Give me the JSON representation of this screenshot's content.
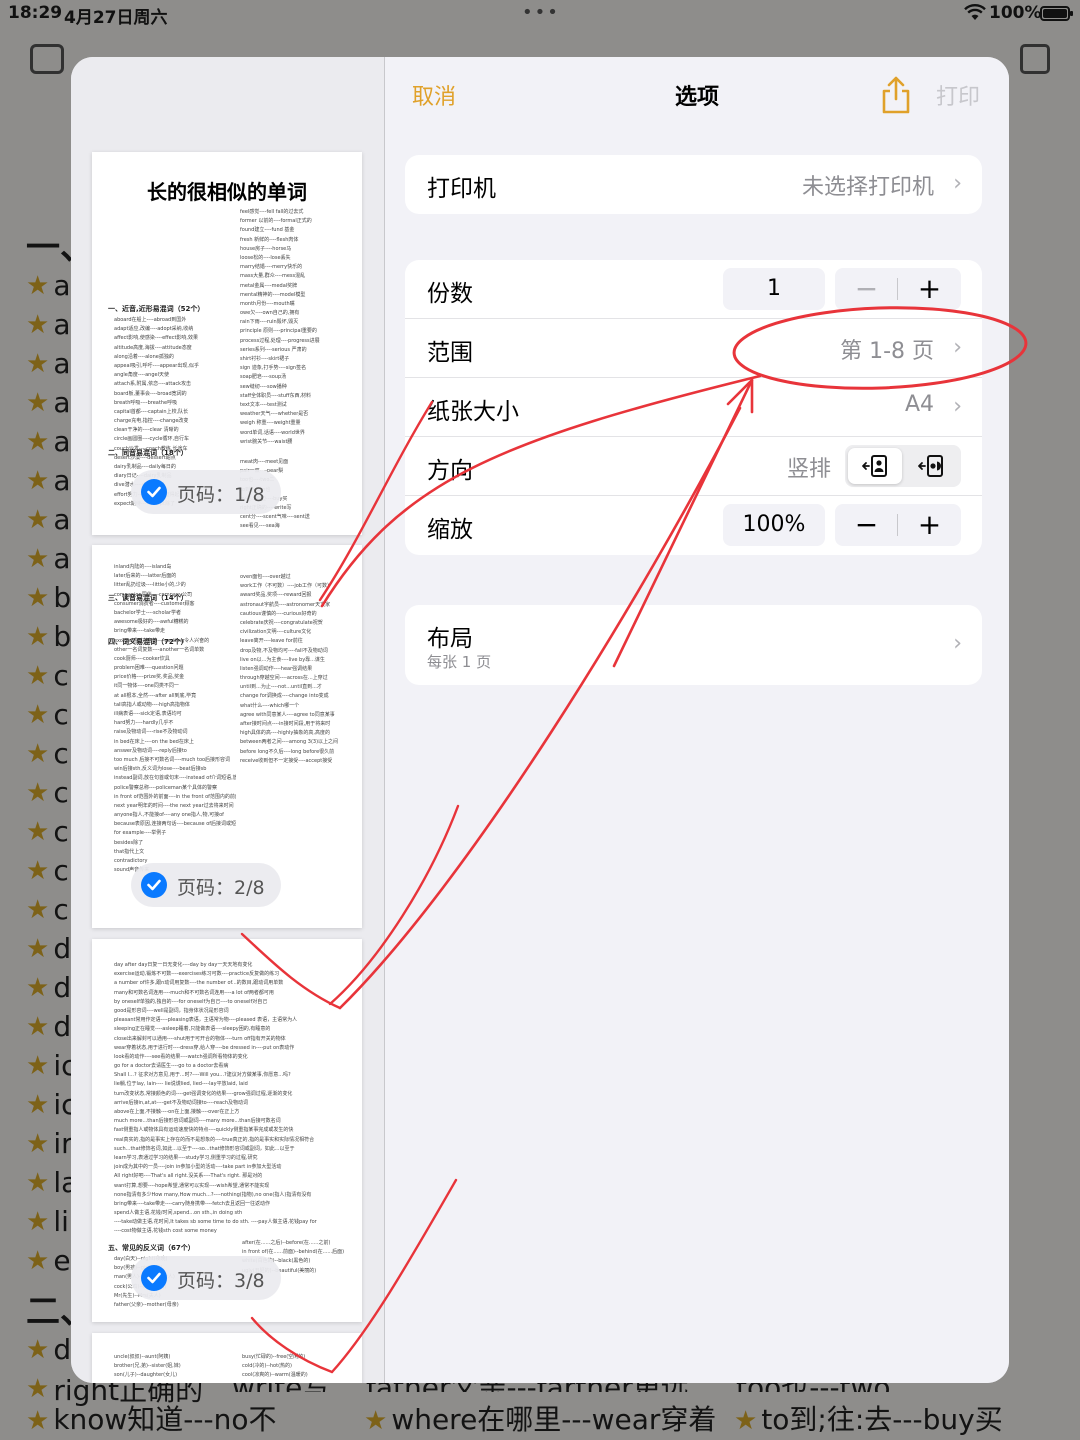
{
  "status_bar": {
    "time": "18:29",
    "date": "4月27日周六",
    "battery": "100%"
  },
  "background": {
    "left_heading_1": "一、",
    "left_heading_2": "二、",
    "left_rows": [
      "a",
      "a",
      "a",
      "a",
      "a",
      "a",
      "a",
      "a",
      "b",
      "b",
      "c",
      "c",
      "c",
      "c",
      "c",
      "c",
      "c",
      "d",
      "d",
      "d",
      "ic",
      "ic",
      "ir",
      "la",
      "li",
      "e"
    ],
    "left_rows_2": [
      "d",
      "right正确的"
    ],
    "bottom_row": [
      "know知道---no不",
      "where在哪里---wear穿着",
      "to到;往:去---buy买"
    ],
    "bottom_partial": [
      "write写",
      "father父亲---farther更远",
      "too也---two二"
    ]
  },
  "print_options": {
    "cancel": "取消",
    "title": "选项",
    "print": "打印",
    "printer": {
      "label": "打印机",
      "value": "未选择打印机"
    },
    "copies": {
      "label": "份数",
      "value": "1",
      "minus": "−",
      "plus": "+"
    },
    "range": {
      "label": "范围",
      "value": "第 1-8 页"
    },
    "paper_size": {
      "label": "纸张大小",
      "value": "A4"
    },
    "orientation": {
      "label": "方向",
      "value": "竖排"
    },
    "scale": {
      "label": "缩放",
      "value": "100%",
      "minus": "−",
      "plus": "+"
    },
    "layout": {
      "label": "布局",
      "sublabel": "每张 1 页"
    }
  },
  "preview": {
    "badges": [
      "页码：1/8",
      "页码：2/8",
      "页码：3/8"
    ],
    "page1": {
      "title": "长的很相似的单词",
      "heading_1": "一、近音,近形易混词（52个）",
      "heading_2": "二、同音易混词（18个）",
      "col_right": [
        "feel感觉----fell fall的过去式",
        "former 以前的----formal正式的",
        "found建立----fund 基金",
        "fresh 新鲜的----flesh肉体",
        "house房子----horse马",
        "loose松的----lose丢失",
        "marry结婚----merry快乐的",
        "mass大量,群众----mess混乱",
        "metal金属----medal奖牌",
        "mental精神的----model模型",
        "month月份----mouth嘴",
        "owe欠----own自己的,拥有",
        "rain下雨----ruin毁坏,毁灭",
        "principle 原则----principal重要的",
        "process过程,处理----progress进展",
        "series系列----serious 严肃的",
        "shirt衬衫----skirt裙子",
        "sign 迹象,打手势----sign签名",
        "soap肥皂----soup汤",
        "sew缝纫----sow播种",
        "staff全体职员----stuff东西,材料",
        "text文本----test测试",
        "weather天气----whether是否",
        "weigh 称重----weight重量",
        "word单词,话语----world世界",
        "wrist腕关节----waist腰"
      ],
      "col_left": [
        "aboard在船上----abroad到国外",
        "adapt适应,改编----adopt采纳,收纳",
        "affect影响,使感染----effect影响,效果",
        "altitude高度,海拔----attitude态度",
        "along沿着----alone孤独的",
        "appeal吸引,呼吁----appear出现,似乎",
        "angle角度----angel天使",
        "attach系,附属,依恋----attack攻击",
        "board板,董事会----broad宽阔的",
        "breath呼吸----breathe呼吸",
        "capital首都----captain上校,队长",
        "charge充电,指控----change改变",
        "clean干净的----clear 清晰的",
        "circle画圆圈----cycle循环,自行车",
        "couch沙发----coach教练,长途车",
        "desert沙漠----dessert甜点",
        "dairy乳制品----daily每日的",
        "diary日记----dairy乳制品",
        "dive潜水----drive驾驶",
        "effort努力----afford负担得起",
        "expect期待----except除了"
      ],
      "col_bottom_right": [
        "meat肉----meet见面",
        "pair一双----pear梨",
        "too也----two二",
        "to到----too也",
        "by在...旁边----buy买",
        "right正确的----write写",
        "cent分----scent气味----sent送",
        "see看见----sea海"
      ]
    },
    "page2": {
      "heading_1": "三、读音易混词（14个）",
      "heading_2": "四、词义易混词（72个）",
      "col_left": [
        "inland内陆的----island岛",
        "later后来的----latter后面的",
        "litter乱扔垃圾----little小的,少的",
        "companion同伴----company公司",
        "consumer消费者----customer顾客",
        "bachelor学士----scholar学者",
        "awesome极好的----awful糟糕的",
        "bring带来----take带走",
        "excited感到兴奋的----exciting令人兴奋的",
        "other一名词复数----another一名词单数",
        "cook厨师----cooker炊具",
        "problem困难----question问题",
        "price价格----prize奖,奖品,奖金",
        "it同一物体----one同类不同一",
        "at all根本,全然----after all到底,毕竟",
        "tall高指人或动物----high高指物体",
        "ill病表语----sick定语,表语均可",
        "hard努力----hardly几乎不",
        "raise及物动词----rise不及物动词",
        "in bed在床上----on the bed在床上",
        "answer及物动词----reply后接to",
        "too much 后接不可数名词----much too后接形容词",
        "win后接sth,反义词为lose----beat后接sb",
        "instead副词,放在句首或句末----instead of介词短语,放句中",
        "police警察总称----policeman某个具体的警察",
        "in front of范围外的前面----in the front of范围内的前面",
        "next year明年的时间----the next year过去将来时间",
        "anyone指人,不能接of----any one指人,物,可接of",
        "because表原因,连接两句话----because of后接词或短语",
        "for example----举例子",
        "besides除了",
        "that指代上文",
        "contradictory",
        "sound声音传来"
      ],
      "col_right": [
        "oven面包----over越过",
        "work工作（不可数）----job工作（可数）",
        "award奖品,奖项----reward回报",
        "astronaut宇航员----astronomer天文家",
        "cautious谨慎的----curious好奇的",
        "celebrate庆祝----congratulate祝贺",
        "civilization文明----culture文化",
        "leave离开----leave for前往",
        "drop及物,不及物均可----fall不及物动词",
        "live on以...为主食----live by靠...谋生",
        "listen强调动作----hear强调结果",
        "through穿越空间----across在...上穿过",
        "until到...为止----not...until直到...才",
        "change for调换成----change into变成",
        "what什么----which哪一个",
        "agree with同意某人----agree to同意某事",
        "after接时间点----in接时间段,用于将来时",
        "high具体的高----highly抽象的高,高度的",
        "between两者之间----among 3(3)以上之间",
        "before long不久后----long before很久前",
        "receive收到但不一定接受----accept接受"
      ]
    },
    "page3": {
      "heading": "五、常见的反义词（67个）",
      "col_lines": [
        "day after day日复一日无变化----day by day一天天地有变化",
        "exercise运动,锻炼不可数----exercises练习可数----practice反复做的练习",
        "a number of许多,跟n动词用复数----the number of...的数目,跟动词用单数",
        "many和可数名词连用----much和不可数名词连用----a lot of两者都可用",
        "by oneself单独的,独自的----for oneself为自己----to oneself对自己",
        "good是形容词----well是副词，指身体状况是形容词",
        "pleasant常用作定语----pleasing表语，主语常为物----pleased 表语，主语常为人",
        "sleeping正在睡觉----asleep睡着,只能做表语----sleepy困的,有睡意的",
        "close出来解封可以通用----shut用于可开合的物体----turn off指有开关的物体",
        "wear穿着状态,用于进行时----dress穿,给人穿----be dressed in----put on表动作",
        "look看的动作----see看的结果----watch强调所看物体的变化",
        "go for a doctor去请医生----go to a doctor去看病",
        "Shall I...? 征求对方意见,用于...时?----Will you...?建议对方做某事,你愿意...吗?",
        "lie躺,位于lay, lain---- lie说谎lied, lied----lay平放laid, laid",
        "turn改变状态,常接颜色的词----get强调变化的结果----grow强调过程,逐渐的变化",
        "arrive后接in,at,at----get不及物动词接to----reach及物动词",
        "above在上面,不接触----on在上面,接触----over在正上方",
        "much more...than后接形容词或副词----many more...than后接可数名词",
        "fast侧重指人或物体具有运动速度快的特点----quickly侧重指某事完成或发生的快",
        "real真实的,指的是事实上存在的而不是想象的----true真正的,指的是事实和实际情况相符合",
        "such...that修饰名词,如此...以至于----so...that修饰形容词或副词，如此...以至于",
        "learn学习,表通过学习的结果----study学习,侧重学习的过程,研究",
        "join成为其中的一员----join in参加小型的活动----take part in参加大型活动",
        "All right好吧----That's all right.没关系----That's right. 那是对的",
        "want打算,想要----hope希望,通常可以实现----wish希望,通常不能实现",
        "none指清有多少How many,How much...?----nothing(指物),no one(指人)指清有没有",
        "bring带来----take带走----carry随身携带----fetch去且返回一往返动作",
        "spend人做主语,花钱/时间,spend...on sth.,in doing sth",
        "----take动做主语,花时间,It takes sb some time to do sth. ----pay人做主语,花钱pay for",
        "----cost物做主语,花钱sth cost some money"
      ],
      "col_bottom_left": [
        "day(白天)--night(夜晚)",
        "boy(男孩)--girl(女孩)",
        "man(男人)--woman(女人)",
        "cock(公鸡)--hen(母鸡)",
        "Mr(先生)--Mrs(夫人)",
        "father(父亲)--mother(母亲)"
      ],
      "col_bottom_right": [
        "after(在......之后)--before(在......之前)",
        "in front of(在......前面)--behind(在......后面)",
        "white(白色的)--black(黑色的)",
        "ugly(丑陋的)--beautiful(美丽的)"
      ]
    },
    "page4": {
      "col_left": [
        "uncle(叔叔)--aunt(阿姨)",
        "brother(兄,弟)--sister(姐,妹)",
        "son(儿子)--daughter(女儿)"
      ],
      "col_right": [
        "busy(忙碌的)--free(空闲的)",
        "cold(冷的)--hot(热的)",
        "cool(凉爽的)--warm(温暖的)"
      ]
    }
  }
}
